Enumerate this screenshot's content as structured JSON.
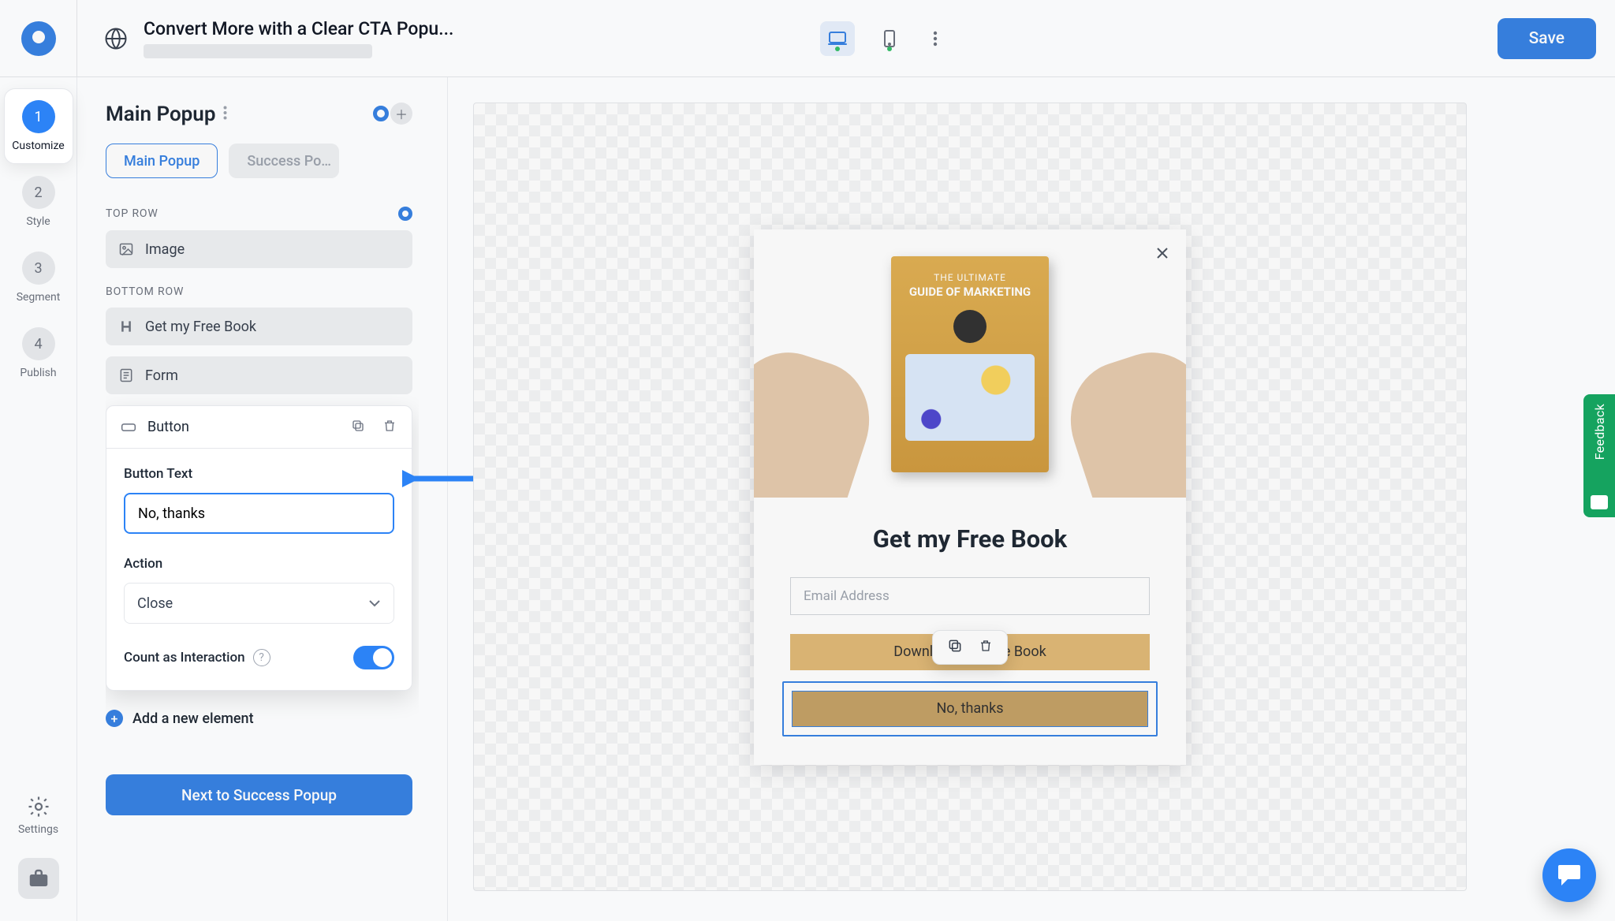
{
  "header": {
    "title": "Convert More with a Clear CTA Popu...",
    "save": "Save"
  },
  "steps": [
    {
      "num": "1",
      "label": "Customize",
      "active": true
    },
    {
      "num": "2",
      "label": "Style"
    },
    {
      "num": "3",
      "label": "Segment"
    },
    {
      "num": "4",
      "label": "Publish"
    }
  ],
  "rail": {
    "settings": "Settings"
  },
  "panel": {
    "title": "Main Popup",
    "tabs": {
      "main": "Main Popup",
      "success": "Success Po…"
    },
    "top_row": "TOP ROW",
    "bottom_row": "BOTTOM ROW",
    "blocks": {
      "image": "Image",
      "headline": "Get my Free Book",
      "form": "Form"
    },
    "button_card": {
      "title": "Button",
      "button_text_label": "Button Text",
      "button_text_value": "No, thanks",
      "action_label": "Action",
      "action_value": "Close",
      "count_label": "Count as Interaction"
    },
    "add_element": "Add a new element",
    "next": "Next to Success Popup"
  },
  "popup": {
    "book": {
      "line1": "THE ULTIMATE",
      "line2": "GUIDE OF MARKETING"
    },
    "headline": "Get my Free Book",
    "email_placeholder": "Email Address",
    "cta": "Download my Free Book",
    "no_thanks": "No, thanks"
  },
  "feedback": "Feedback"
}
